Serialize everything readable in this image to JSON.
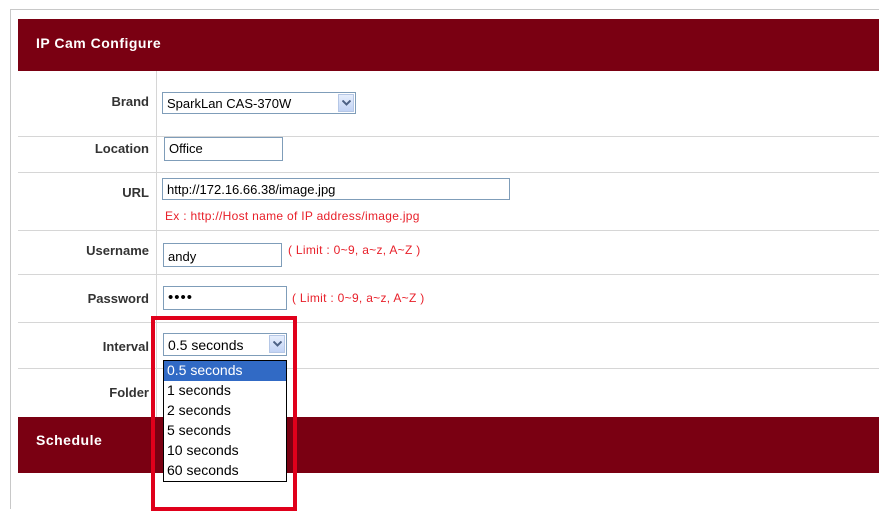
{
  "config": {
    "title": "IP Cam Configure",
    "brand": {
      "label": "Brand",
      "value": "SparkLan CAS-370W"
    },
    "location": {
      "label": "Location",
      "value": "Office"
    },
    "url": {
      "label": "URL",
      "value": "http://172.16.66.38/image.jpg",
      "hint": "Ex : http://Host name of IP address/image.jpg"
    },
    "username": {
      "label": "Username",
      "value": "andy",
      "hint": "( Limit : 0~9, a~z, A~Z )"
    },
    "password": {
      "label": "Password",
      "value": "••••",
      "hint": "( Limit : 0~9, a~z, A~Z )"
    },
    "interval": {
      "label": "Interval",
      "value": "0.5 seconds",
      "options": [
        "0.5 seconds",
        "1 seconds",
        "2 seconds",
        "5 seconds",
        "10 seconds",
        "60 seconds"
      ],
      "selected_index": 0
    },
    "folder": {
      "label": "Folder"
    }
  },
  "schedule": {
    "title": "Schedule"
  },
  "colors": {
    "header_bg": "#7a0012",
    "hint": "#e8202a",
    "highlight": "#e0001b",
    "selection": "#316ac5"
  }
}
